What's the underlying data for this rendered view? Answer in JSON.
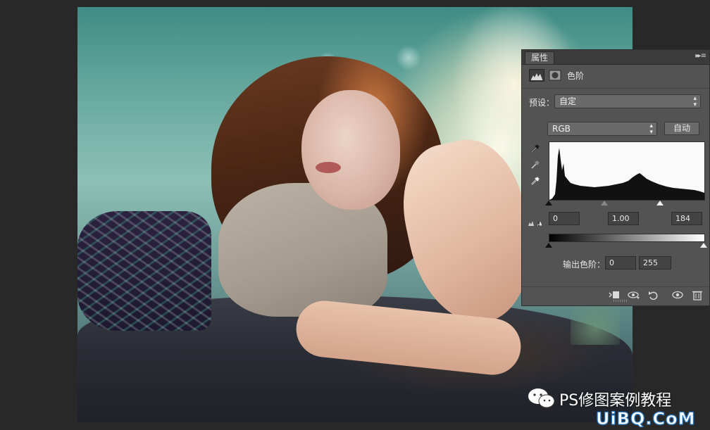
{
  "panel": {
    "tab_label": "属性",
    "menu_glyph": "▸▸ ≡",
    "title": "色阶",
    "preset_label": "预设：",
    "preset_value": "自定",
    "channel_value": "RGB",
    "auto_label": "自动",
    "input_black": "0",
    "input_gamma": "1.00",
    "input_white": "184",
    "output_label": "输出色阶：",
    "output_black": "0",
    "output_white": "255",
    "icons": [
      "levels-adjustment-icon",
      "layer-mask-icon",
      "black-point-eyedropper-icon",
      "gray-point-eyedropper-icon",
      "white-point-eyedropper-icon",
      "clip-to-layer-icon",
      "view-previous-state-icon",
      "reset-icon",
      "toggle-visibility-icon",
      "delete-icon"
    ]
  },
  "levels": {
    "input_black_level": 0,
    "input_gamma": 1.0,
    "input_white_level": 184,
    "output_black_level": 0,
    "output_white_level": 255
  },
  "watermark": {
    "text": "PS修图案例教程",
    "site": "UiBQ.CoM"
  }
}
